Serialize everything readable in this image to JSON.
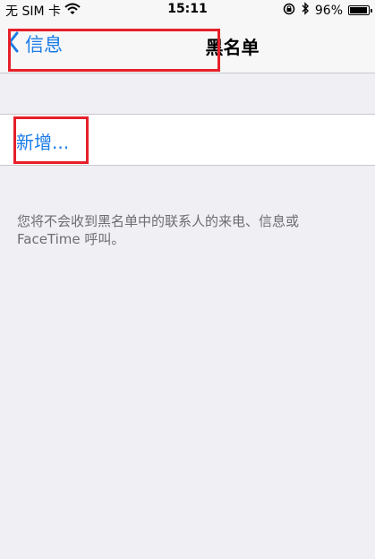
{
  "status_bar": {
    "carrier": "无 SIM 卡",
    "time": "15:11",
    "battery_percent": "96%",
    "battery_level": 0.96
  },
  "nav": {
    "back_label": "信息",
    "title": "黑名单"
  },
  "list": {
    "add_label": "新增..."
  },
  "footer": {
    "description": "您将不会收到黑名单中的联系人的来电、信息或 FaceTime 呼叫。"
  },
  "colors": {
    "accent": "#1a7ce8",
    "highlight": "#e6202a"
  }
}
